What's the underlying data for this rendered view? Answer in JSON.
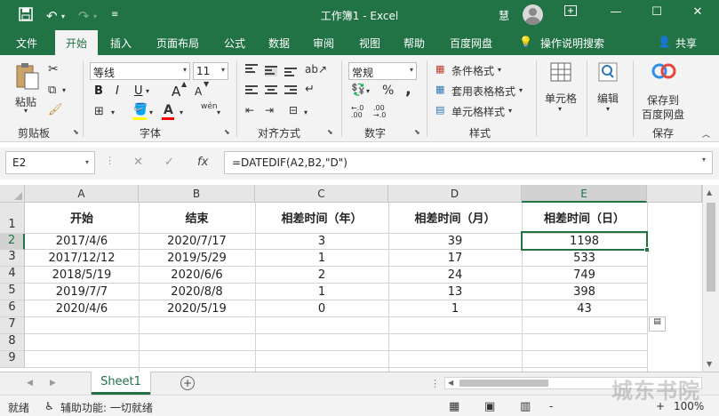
{
  "titlebar": {
    "title": "工作簿1  -  Excel",
    "user": "慧",
    "save_icon": "save-icon",
    "undo_icon": "undo-icon",
    "redo_icon": "redo-icon",
    "customize_icon": "customize-qat-icon"
  },
  "tabs": {
    "file": "文件",
    "home": "开始",
    "insert": "插入",
    "layout": "页面布局",
    "formulas": "公式",
    "data": "数据",
    "review": "审阅",
    "view": "视图",
    "help": "帮助",
    "baidu": "百度网盘",
    "tellme": "操作说明搜索",
    "share": "共享"
  },
  "ribbon": {
    "clipboard": {
      "paste": "粘贴",
      "label": "剪贴板"
    },
    "font": {
      "name": "等线",
      "size": "11",
      "label": "字体",
      "bold": "B",
      "italic": "I",
      "underline": "U",
      "grow": "A",
      "shrink": "A"
    },
    "alignment": {
      "label": "对齐方式"
    },
    "number": {
      "format": "常规",
      "label": "数字",
      "percent": "%",
      "comma": ","
    },
    "styles": {
      "conditional": "条件格式",
      "table": "套用表格格式",
      "cell": "单元格样式",
      "label": "样式"
    },
    "cells": {
      "label": "单元格"
    },
    "editing": {
      "label": "编辑"
    },
    "save": {
      "label_line1": "保存到",
      "label_line2": "百度网盘",
      "group": "保存"
    }
  },
  "formula_bar": {
    "name_box": "E2",
    "formula": "=DATEDIF(A2,B2,\"D\")",
    "fx": "fx"
  },
  "grid": {
    "columns": [
      "A",
      "B",
      "C",
      "D",
      "E"
    ],
    "rows": [
      "1",
      "2",
      "3",
      "4",
      "5",
      "6",
      "7",
      "8",
      "9"
    ],
    "header": [
      "开始",
      "结束",
      "相差时间（年）",
      "相差时间（月）",
      "相差时间（日）"
    ],
    "data": [
      [
        "2017/4/6",
        "2020/7/17",
        "3",
        "39",
        "1198"
      ],
      [
        "2017/12/12",
        "2019/5/29",
        "1",
        "17",
        "533"
      ],
      [
        "2018/5/19",
        "2020/6/6",
        "2",
        "24",
        "749"
      ],
      [
        "2019/7/7",
        "2020/8/8",
        "1",
        "13",
        "398"
      ],
      [
        "2020/4/6",
        "2020/5/19",
        "0",
        "1",
        "43"
      ]
    ]
  },
  "sheets": {
    "active": "Sheet1",
    "add": "+"
  },
  "status": {
    "ready": "就绪",
    "accessibility": "辅助功能: 一切就绪",
    "zoom": "100%",
    "minus": "-",
    "plus": "+"
  },
  "watermark": "城东书院"
}
